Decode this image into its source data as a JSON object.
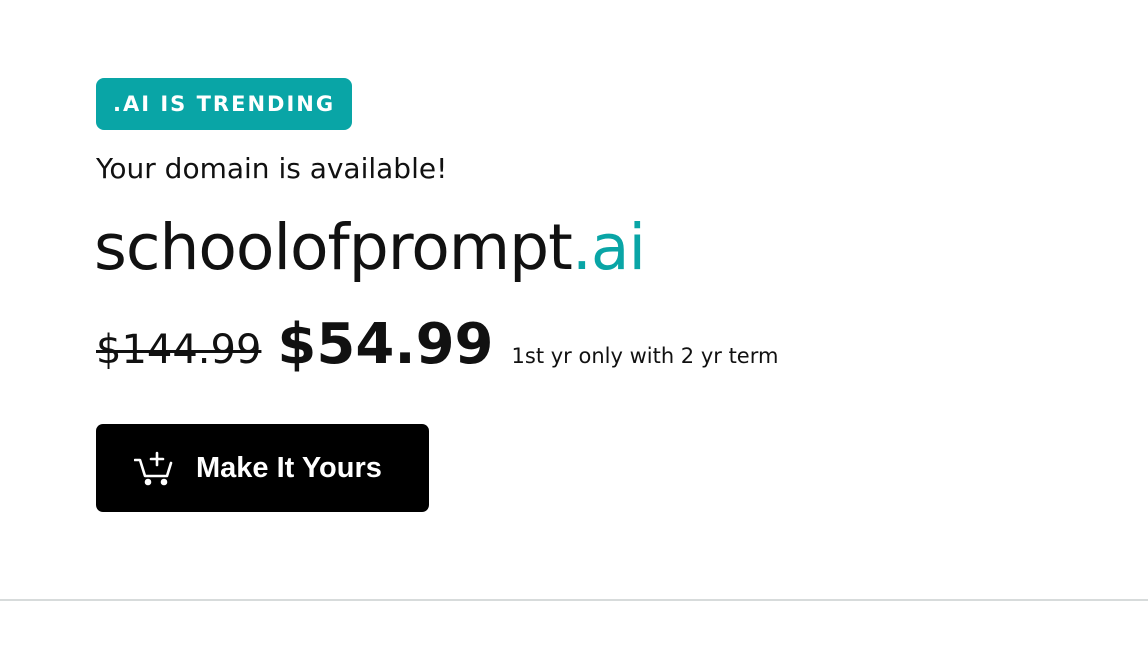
{
  "badge": {
    "label": ".AI IS TRENDING"
  },
  "headline": "Your domain is available!",
  "domain": {
    "name": "schoolofprompt",
    "tld": ".ai"
  },
  "pricing": {
    "original_price": "$144.99",
    "sale_price": "$54.99",
    "term_note": "1st yr only with 2 yr term"
  },
  "cta": {
    "label": "Make It Yours",
    "icon": "cart-add-icon"
  },
  "colors": {
    "accent": "#09a5a6",
    "button_bg": "#000000",
    "text": "#111111",
    "divider": "#d7dbdb"
  }
}
